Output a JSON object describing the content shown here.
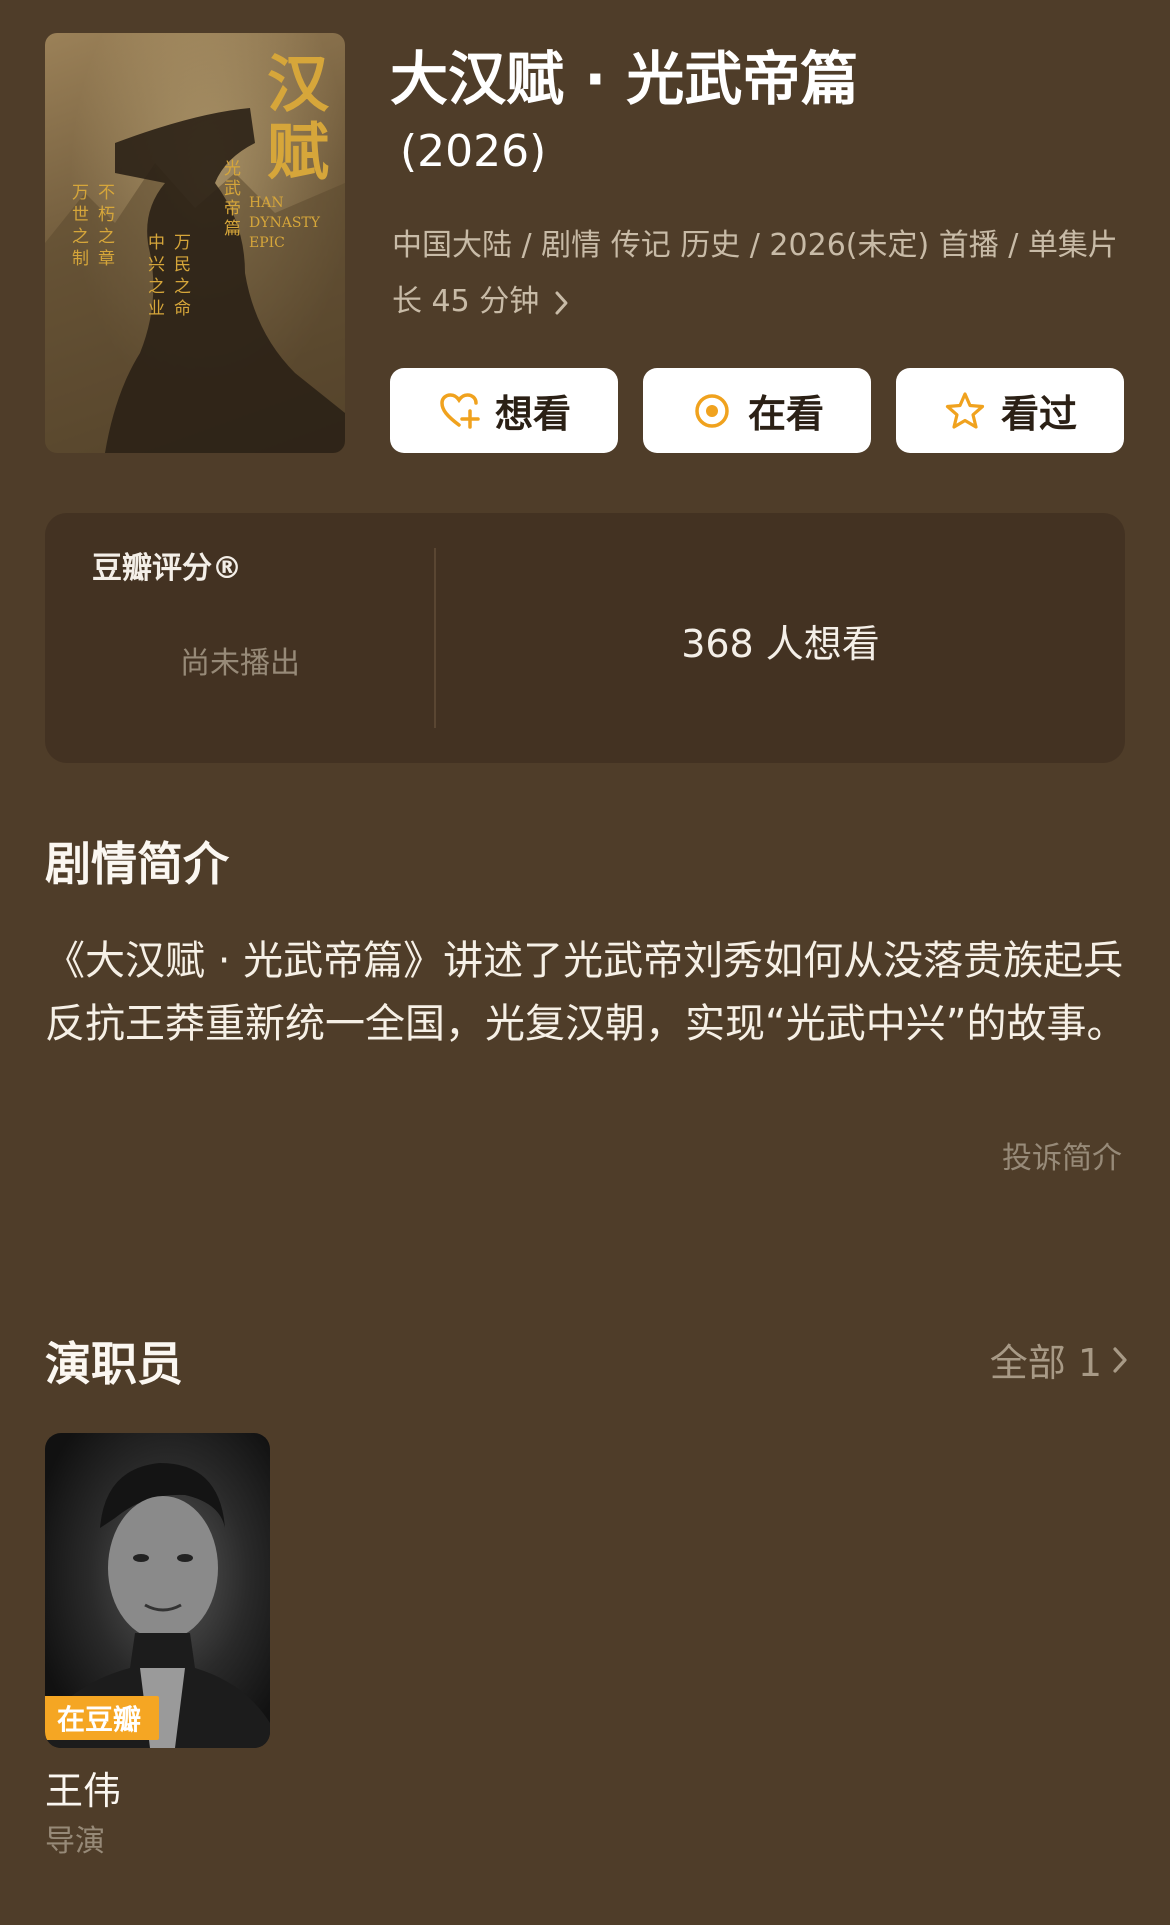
{
  "show": {
    "title": "大汉赋 · 光武帝篇",
    "year": "(2026)",
    "meta": "中国大陆 / 剧情 传记 历史 / 2026(未定) 首播 / 单集片长 45 分钟",
    "poster": {
      "main_title": "汉赋",
      "sub_title": "光武帝篇",
      "english": "HAN DYNASTY EPIC",
      "v1": "万世之制",
      "v2": "不朽之章",
      "v3": "中兴之业",
      "v4": "万民之命"
    }
  },
  "actions": {
    "want": "想看",
    "watching": "在看",
    "watched": "看过"
  },
  "rating": {
    "label": "豆瓣评分®",
    "status": "尚未播出",
    "want_count": "368 人想看"
  },
  "synopsis": {
    "title": "剧情简介",
    "text": "《大汉赋 · 光武帝篇》讲述了光武帝刘秀如何从没落贵族起兵反抗王莽重新统一全国，光复汉朝，实现“光武中兴”的故事。",
    "report": "投诉简介"
  },
  "cast": {
    "title": "演职员",
    "all_label": "全部 1",
    "members": [
      {
        "name": "王伟",
        "role": "导演",
        "badge": "在豆瓣"
      }
    ]
  },
  "colors": {
    "background": "#4f3d29",
    "card": "#433222",
    "accent": "#f5a623",
    "icon_orange": "#f0a21e"
  }
}
